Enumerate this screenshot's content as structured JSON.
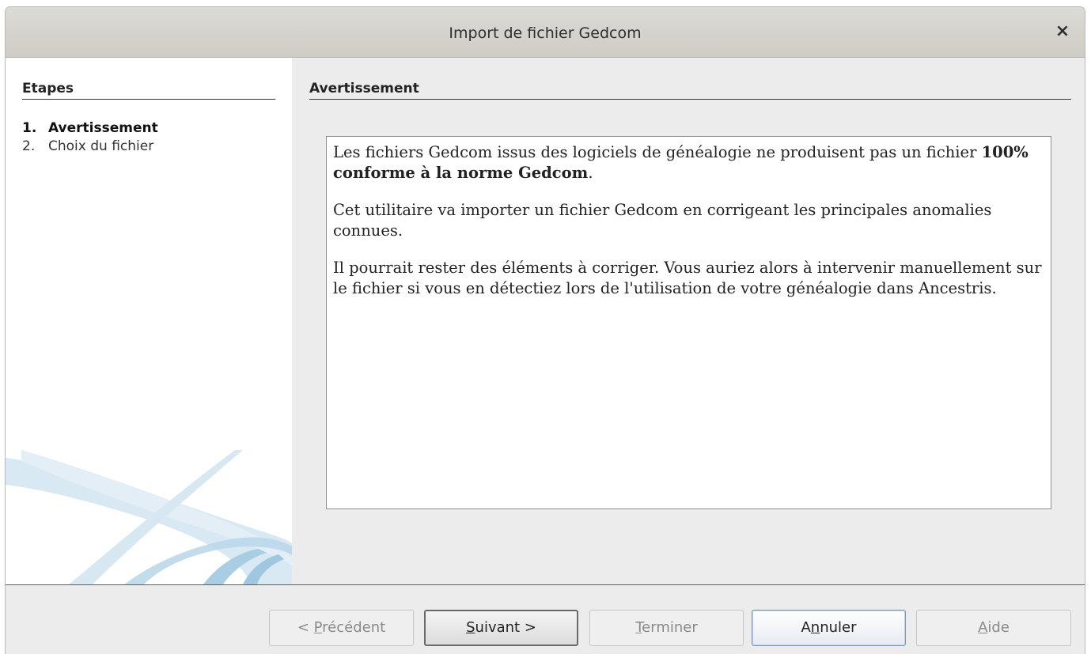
{
  "window": {
    "title": "Import de fichier Gedcom",
    "close_label": "×"
  },
  "sidebar": {
    "title": "Etapes",
    "steps": [
      {
        "num": "1.",
        "label": "Avertissement",
        "active": true
      },
      {
        "num": "2.",
        "label": "Choix du fichier",
        "active": false
      }
    ]
  },
  "main": {
    "section_title": "Avertissement",
    "paragraphs": {
      "p1_part1": "Les fichiers Gedcom issus des logiciels de généalogie ne produisent pas un fichier ",
      "p1_bold": "100% conforme à la norme Gedcom",
      "p1_end": ".",
      "p2": "Cet utilitaire va importer un fichier Gedcom en corrigeant les principales anomalies connues.",
      "p3": "Il pourrait rester des éléments à corriger. Vous auriez alors à intervenir manuellement sur le fichier si vous en détectiez lors de l'utilisation de votre généalogie dans Ancestris."
    }
  },
  "buttons": {
    "previous": {
      "pre": "< ",
      "mnemonic": "P",
      "post": "récédent",
      "enabled": false
    },
    "next": {
      "pre": "",
      "mnemonic": "S",
      "post": "uivant >",
      "enabled": true
    },
    "finish": {
      "pre": "",
      "mnemonic": "T",
      "post": "erminer",
      "enabled": false
    },
    "cancel": {
      "pre": "A",
      "mnemonic": "n",
      "post": "nuler",
      "enabled": true
    },
    "help": {
      "pre": "",
      "mnemonic": "A",
      "post": "ide",
      "enabled": false
    }
  },
  "colors": {
    "swoosh": "#bcd8ea",
    "disabled_text": "#8a8a8a"
  }
}
